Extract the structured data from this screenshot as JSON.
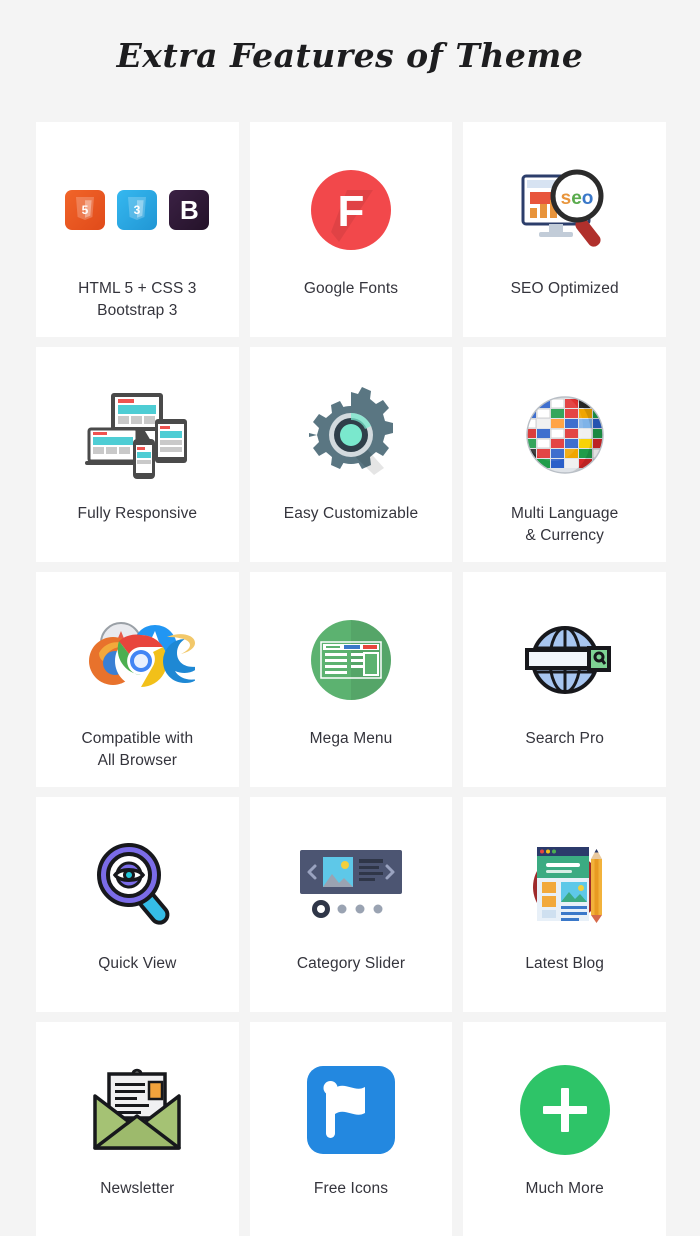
{
  "page": {
    "title": "Extra Features of Theme",
    "background_color": "#f4f4f4",
    "card_color": "#ffffff",
    "label_color": "#34343c"
  },
  "features": [
    {
      "id": "html-css-bootstrap",
      "label": "HTML 5 + CSS 3\nBootstrap 3",
      "icon": "html5-css3-bootstrap-badges-icon",
      "badges": [
        {
          "text": "5",
          "color": "#e8602c"
        },
        {
          "text": "3",
          "color": "#35a8e0"
        },
        {
          "text": "B",
          "color": "#2d1b35"
        }
      ]
    },
    {
      "id": "google-fonts",
      "label": "Google Fonts",
      "icon": "google-fonts-icon",
      "letter": "F",
      "color": "#f2484b"
    },
    {
      "id": "seo-optimized",
      "label": "SEO Optimized",
      "icon": "seo-magnifier-monitor-icon",
      "text": "seo",
      "color": "#c0392b"
    },
    {
      "id": "fully-responsive",
      "label": "Fully Responsive",
      "icon": "responsive-devices-icon",
      "color": "#4a4a4a",
      "accent": "#4ecdd4"
    },
    {
      "id": "easy-customizable",
      "label": "Easy Customizable",
      "icon": "gear-icon",
      "color": "#5a7682",
      "accent": "#7ae8cd"
    },
    {
      "id": "multi-language-currency",
      "label": "Multi Language\n& Currency",
      "icon": "flags-globe-icon",
      "color": "#2b4fa0"
    },
    {
      "id": "compatible-all-browser",
      "label": "Compatible with\nAll Browser",
      "icon": "browsers-icon",
      "color": "#2196f3"
    },
    {
      "id": "mega-menu",
      "label": "Mega Menu",
      "icon": "mega-menu-icon",
      "color": "#5cb270"
    },
    {
      "id": "search-pro",
      "label": "Search Pro",
      "icon": "search-globe-icon",
      "color": "#a8c6f0",
      "accent": "#7ed394"
    },
    {
      "id": "quick-view",
      "label": "Quick View",
      "icon": "eye-magnifier-icon",
      "color": "#7b6ce8",
      "accent": "#35bde8"
    },
    {
      "id": "category-slider",
      "label": "Category Slider",
      "icon": "category-slider-icon",
      "color": "#4c5572",
      "dots": 4,
      "active_dot": 1
    },
    {
      "id": "latest-blog",
      "label": "Latest Blog",
      "icon": "blog-pencil-icon",
      "color": "#9e2a2b",
      "accent": "#f2a93b"
    },
    {
      "id": "newsletter",
      "label": "Newsletter",
      "icon": "envelope-icon",
      "color": "#a5c274",
      "accent": "#f2a33c"
    },
    {
      "id": "free-icons",
      "label": "Free Icons",
      "icon": "flag-icon",
      "color": "#2388e0"
    },
    {
      "id": "much-more",
      "label": "Much More",
      "icon": "plus-circle-icon",
      "color": "#2ec468"
    }
  ]
}
